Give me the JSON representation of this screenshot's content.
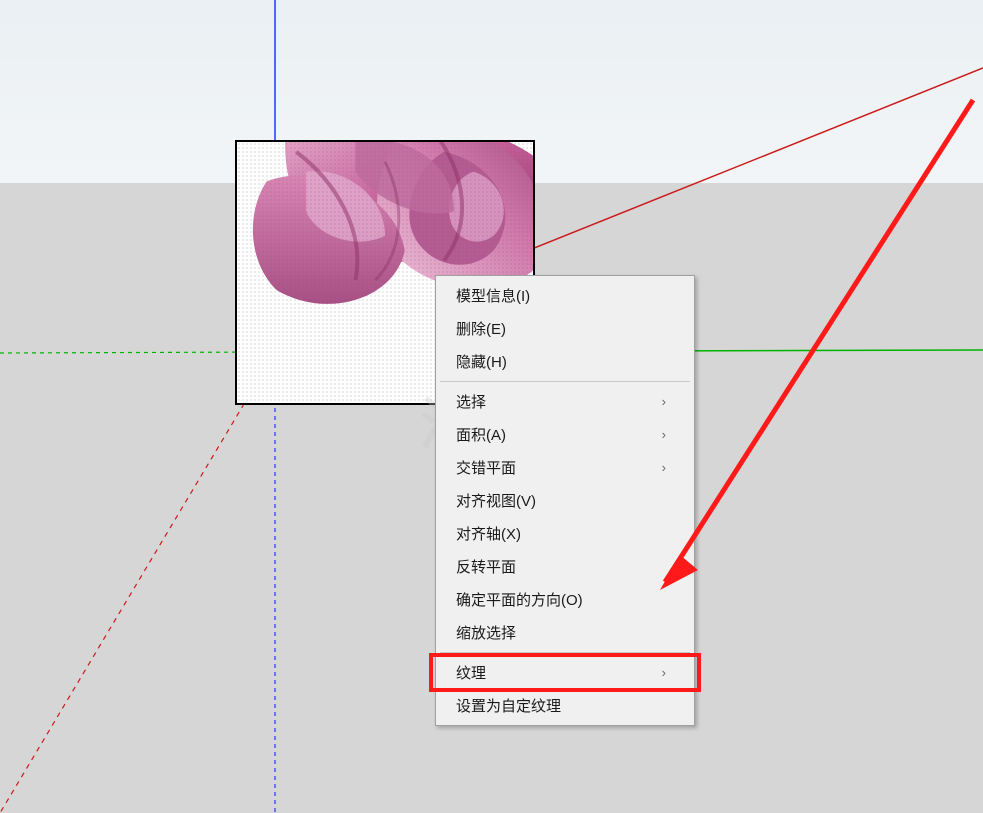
{
  "menu": {
    "items": [
      {
        "label": "模型信息(I)",
        "submenu": false,
        "sep_after": false
      },
      {
        "label": "删除(E)",
        "submenu": false,
        "sep_after": false
      },
      {
        "label": "隐藏(H)",
        "submenu": false,
        "sep_after": true
      },
      {
        "label": "选择",
        "submenu": true,
        "sep_after": false
      },
      {
        "label": "面积(A)",
        "submenu": true,
        "sep_after": false
      },
      {
        "label": "交错平面",
        "submenu": true,
        "sep_after": false
      },
      {
        "label": "对齐视图(V)",
        "submenu": false,
        "sep_after": false
      },
      {
        "label": "对齐轴(X)",
        "submenu": false,
        "sep_after": false
      },
      {
        "label": "反转平面",
        "submenu": false,
        "sep_after": false
      },
      {
        "label": "确定平面的方向(O)",
        "submenu": false,
        "sep_after": false
      },
      {
        "label": "缩放选择",
        "submenu": false,
        "sep_after": true
      },
      {
        "label": "纹理",
        "submenu": true,
        "sep_after": false,
        "highlighted": true
      },
      {
        "label": "设置为自定纹理",
        "submenu": false,
        "sep_after": false
      }
    ]
  },
  "watermark_text": "溜网",
  "axes": {
    "blue_color": "#1a1aff",
    "green_color": "#00b300",
    "red_solid": "#cc0000",
    "red_dashed": "#cc0000",
    "blue_dashed": "#1a1aff"
  },
  "arrow_color": "#ff1a1a",
  "highlight_color": "#ff1a1a"
}
